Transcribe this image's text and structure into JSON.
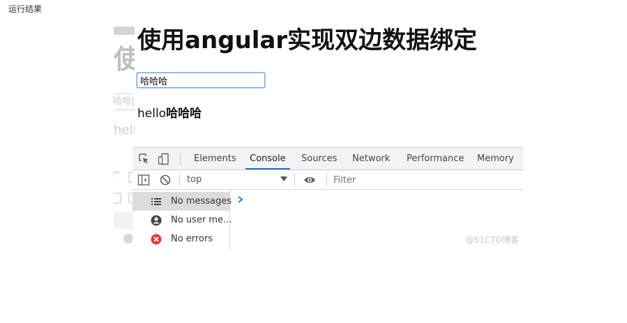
{
  "caption": "运行结果",
  "page": {
    "title": "使用angular实现双边数据绑定",
    "input_value": "哈哈哈",
    "hello_prefix": "hello",
    "hello_name": "哈哈哈"
  },
  "ghost": {
    "title_char": "使",
    "input_text": "哈哈|",
    "hello_text": "hell"
  },
  "devtools": {
    "tabs": [
      "Elements",
      "Console",
      "Sources",
      "Network",
      "Performance",
      "Memory"
    ],
    "active_tab": "Console",
    "context": "top",
    "filter_placeholder": "Filter",
    "sidebar": [
      "No messages",
      "No user me...",
      "No errors"
    ],
    "accent_color": "#1a73e8",
    "error_color": "#e53935",
    "icons": [
      "inspect-icon",
      "device-toggle-icon",
      "sidebar-toggle-icon",
      "clear-console-icon",
      "eye-icon",
      "list-icon",
      "user-icon",
      "error-icon",
      "prompt-chevron-icon"
    ]
  },
  "watermark": "@51CTO博客"
}
